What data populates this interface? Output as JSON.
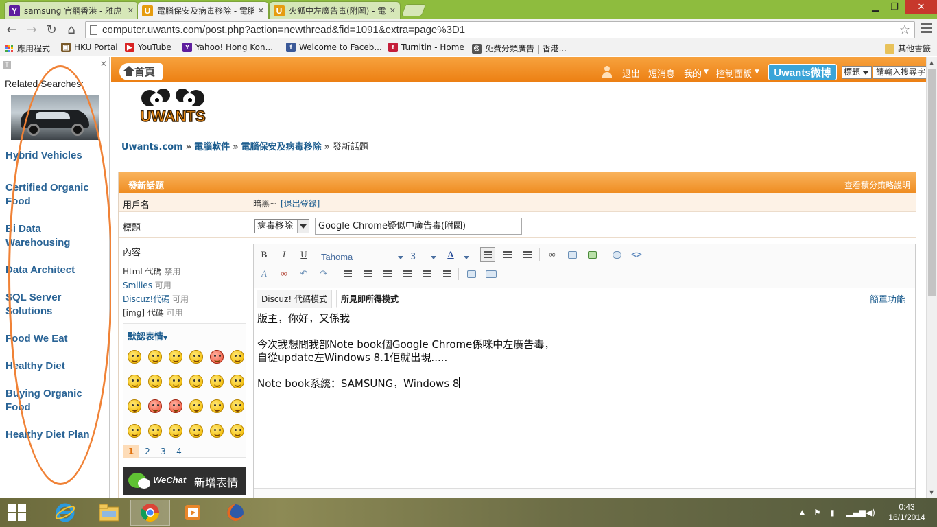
{
  "tabs": [
    {
      "label": "samsung 官網香港 - 雅虎",
      "favicon": "Y"
    },
    {
      "label": "電腦保安及病毒移除 - 電腦",
      "favicon": "U"
    },
    {
      "label": "火狐中左廣告毒(附圖) - 電",
      "favicon": "U"
    }
  ],
  "toolbar": {
    "url": "computer.uwants.com/post.php?action=newthread&fid=1091&extra=page%3D1"
  },
  "bookmarks": [
    {
      "label": "應用程式",
      "icon": "apps-icon"
    },
    {
      "label": "HKU Portal",
      "icon": "hku-icon"
    },
    {
      "label": "YouTube",
      "icon": "youtube-icon"
    },
    {
      "label": "Yahoo! Hong Kon...",
      "icon": "yahoo-icon"
    },
    {
      "label": "Welcome to Faceb...",
      "icon": "facebook-icon"
    },
    {
      "label": "Turnitin - Home",
      "icon": "turnitin-icon"
    },
    {
      "label": "免費分類廣告 | 香港...",
      "icon": "classified-icon"
    }
  ],
  "bookmarks_other": "其他書籤",
  "leftad": {
    "title": "Related Searches:",
    "links": [
      "Hybrid Vehicles",
      "Certified Organic Food",
      "Bi Data Warehousing",
      "Data Architect",
      "SQL Server Solutions",
      "Food We Eat",
      "Healthy Diet",
      "Buying Organic Food",
      "Healthy Diet Plan"
    ]
  },
  "topnav": {
    "home": "首頁",
    "logout": "退出",
    "messages": "短消息",
    "mine": "我的",
    "control_panel": "控制面板",
    "weibo": "Uwants微博",
    "search_type": "標題",
    "search_placeholder": "請輸入搜尋字"
  },
  "logo": {
    "text": "UWANTS"
  },
  "breadcrumb": {
    "items": [
      "Uwants.com",
      "電腦軟件",
      "電腦保安及病毒移除"
    ],
    "separator": "»",
    "current": "發新話題"
  },
  "form": {
    "header": "發新話題",
    "header_right": "查看積分策略說明",
    "username_label": "用戶名",
    "username": "暗黑~",
    "logout_link": "[退出登錄]",
    "title_label": "標題",
    "topic_type": "病毒移除",
    "title_value": "Google Chrome疑似中廣告毒(附圖)",
    "content_label": "內容",
    "side_info": [
      {
        "key": "Html 代碼",
        "val": "禁用"
      },
      {
        "key": "Smilies",
        "val": "可用"
      },
      {
        "key": "Discuz!代碼",
        "val": "可用"
      },
      {
        "key": "[img] 代碼",
        "val": "可用"
      }
    ],
    "smilies_title": "默認表情",
    "smilies_pages": [
      "1",
      "2",
      "3",
      "4"
    ],
    "wechat_brand": "WeChat",
    "wechat_text": "新增表情"
  },
  "editor": {
    "font": "Tahoma",
    "size": "3",
    "tabs": [
      "Discuz! 代碼模式",
      "所見即所得模式"
    ],
    "simple_mode": "簡單功能",
    "lines": [
      "版主，你好，又係我",
      "",
      "今次我想問我部Note book個Google Chrome係咪中左廣告毒，",
      "自從update左Windows 8.1佢就出現.....",
      "",
      "Note book系統：SAMSUNG，Windows 8"
    ]
  },
  "taskbar": {
    "time": "0:43",
    "date": "16/1/2014"
  }
}
